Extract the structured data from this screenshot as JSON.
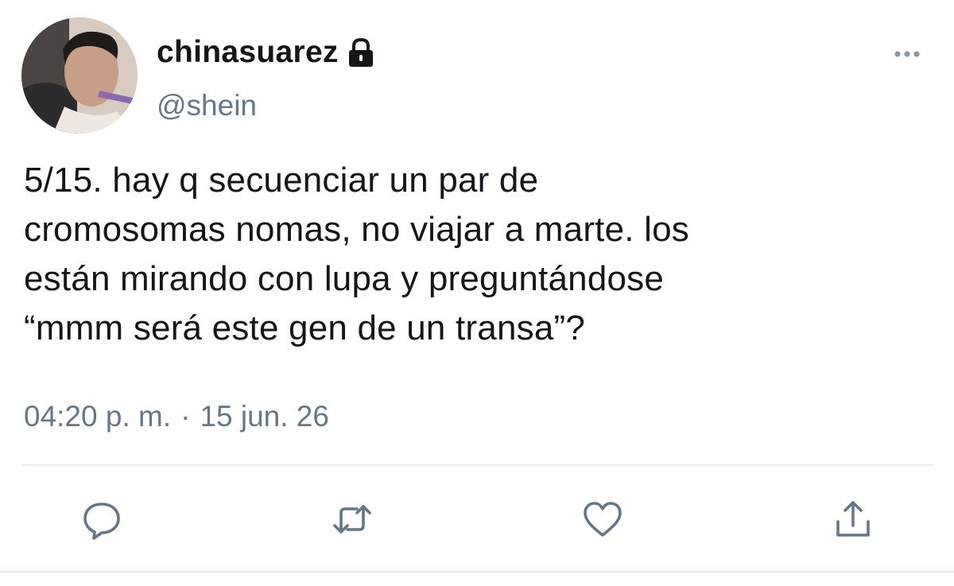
{
  "user": {
    "display_name": "chinasuarez",
    "handle": "@shein",
    "verified_lock": "lock-icon",
    "avatar": "profile-photo"
  },
  "tweet": {
    "text": "5/15. hay q secuenciar un par de\ncromosomas nomas, no viajar a marte. los\nestán mirando con lupa y preguntándose\n“mmm será este gen de un transa”?",
    "time": "04:20 p. m.",
    "separator": "·",
    "date": "15 jun. 26"
  },
  "actions": [
    {
      "name": "reply",
      "icon": "reply-icon"
    },
    {
      "name": "retweet",
      "icon": "retweet-icon"
    },
    {
      "name": "like",
      "icon": "heart-icon"
    },
    {
      "name": "share",
      "icon": "share-icon"
    }
  ],
  "colors": {
    "text": "#14171a",
    "secondary": "#657786",
    "divider": "#e6ecf0"
  }
}
